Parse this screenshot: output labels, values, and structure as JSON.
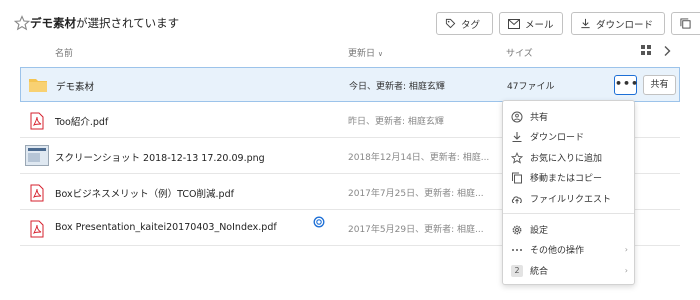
{
  "header": {
    "title_bold": "デモ素材",
    "title_rest": "が選択されています",
    "buttons": {
      "tag": "タグ",
      "mail": "メール",
      "download": "ダウンロード"
    }
  },
  "columns": {
    "name": "名前",
    "modified": "更新日",
    "size": "サイズ"
  },
  "rows": [
    {
      "name": "デモ素材",
      "modified": "今日、更新者: 相庭玄輝",
      "size": "47ファイル",
      "icon": "folder-icon"
    },
    {
      "name": "Too紹介.pdf",
      "modified": "昨日、更新者: 相庭玄輝",
      "icon": "pdf-icon"
    },
    {
      "name": "スクリーンショット 2018-12-13 17.20.09.png",
      "modified": "2018年12月14日、更新者: 相庭...",
      "icon": "image-thumbnail"
    },
    {
      "name": "Boxビジネスメリット（例）TCO削減.pdf",
      "modified": "2017年7月25日、更新者: 相庭...",
      "icon": "pdf-icon"
    },
    {
      "name": "Box Presentation_kaitei20170403_NoIndex.pdf",
      "modified": "2017年5月29日、更新者: 相庭...",
      "icon": "pdf-icon"
    }
  ],
  "row_actions": {
    "more": "•••",
    "share": "共有"
  },
  "context_menu": {
    "items": [
      {
        "label": "共有",
        "icon": "share-icon"
      },
      {
        "label": "ダウンロード",
        "icon": "download-icon"
      },
      {
        "label": "お気に入りに追加",
        "icon": "star-icon"
      },
      {
        "label": "移動またはコピー",
        "icon": "copy-icon"
      },
      {
        "label": "ファイルリクエスト",
        "icon": "upload-cloud-icon"
      },
      {
        "label": "設定",
        "icon": "gear-icon"
      },
      {
        "label": "その他の操作",
        "icon": "more-icon",
        "submenu": true
      },
      {
        "label": "統合",
        "icon": "integrations-badge",
        "badge": "2",
        "submenu": true
      }
    ],
    "submenu_arrow": "›"
  },
  "colors": {
    "accent": "#1d6fd6",
    "selected_bg": "#e8f2fb",
    "pdf_red": "#d6212e",
    "folder": "#f4c451"
  }
}
